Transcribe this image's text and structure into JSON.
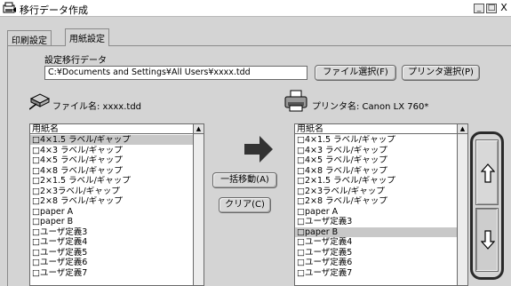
{
  "window": {
    "title": "移行データ作成",
    "min_glyph": "_",
    "max_glyph": "□",
    "close_glyph": "X"
  },
  "tabs": [
    {
      "label": "印刷設定",
      "active": false
    },
    {
      "label": "用紙設定",
      "active": true
    }
  ],
  "settings": {
    "group_label": "設定移行データ",
    "path_value": "C:¥Documents and Settings¥All Users¥xxxx.tdd",
    "file_select_button": "ファイル選択(F)",
    "printer_select_button": "プリンタ選択(P)"
  },
  "file_info": {
    "file_name_label": "ファイル名: xxxx.tdd",
    "printer_name_label": "プリンタ名:  Canon LX 760*"
  },
  "left_list": {
    "header": "用紙名",
    "items": [
      "□4×1.5 ラベル/ギャップ",
      "□4×3 ラベル/ギャップ",
      "□4×5 ラベル/ギャップ",
      "□4×8 ラベル/ギャップ",
      "□2×1.5 ラベル/ギャップ",
      "□2×3ラベル/ギャップ",
      "□2×8 ラベル/ギャップ",
      "□paper A",
      "□paper B",
      "□ユーザ定義3",
      "□ユーザ定義4",
      "□ユーザ定義5",
      "□ユーザ定義6",
      "□ユーザ定義7"
    ],
    "selected_index": 0
  },
  "right_list": {
    "header": "用紙名",
    "items": [
      "□4×1.5 ラベル/ギャップ",
      "□4×3 ラベル/ギャップ",
      "□4×5 ラベル/ギャップ",
      "□4×8 ラベル/ギャップ",
      "□2×1.5 ラベル/ギャップ",
      "□2×3ラベル/ギャップ",
      "□2×8 ラベル/ギャップ",
      "□paper A",
      "□ユーザ定義3",
      "□paper B",
      "□ユーザ定義4",
      "□ユーザ定義5",
      "□ユーザ定義6",
      "□ユーザ定義7"
    ],
    "selected_index": 9
  },
  "middle": {
    "move_all_button": "一括移動(A)",
    "clear_button": "クリア(C)"
  },
  "colors": {
    "window_bg": "#d4d4d4",
    "selected_row": "#c8c8c8",
    "highlight_frame": "#2a2a2a"
  }
}
